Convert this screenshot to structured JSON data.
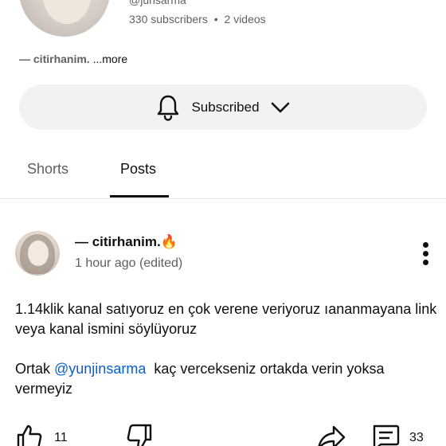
{
  "channel": {
    "handle": "@junsarma",
    "subscribers": "330 subscribers",
    "separator": "•",
    "videos": "2 videos",
    "description": "— citirhanim.",
    "more_label": "...more"
  },
  "subscribe": {
    "label": "Subscribed",
    "bell_icon": "bell-icon",
    "chevron_icon": "chevron-down-icon"
  },
  "tabs": [
    {
      "label": "Shorts",
      "active": false
    },
    {
      "label": "Posts",
      "active": true
    }
  ],
  "post": {
    "author": "— citirhanim.🔥",
    "timestamp": "1 hour ago (edited)",
    "body_line1": "1.14klik kanal satıyoruz en çok verene veriyoruz ıananmayana link veya kanal ismini söylüyoruz",
    "body2_prefix": "Ortak ",
    "mention": "@yunjinsarma",
    "body2_suffix": "  kaç vercekseniz ortakda verin yoksa vermeyiz",
    "likes": "11",
    "comments": "33"
  },
  "colors": {
    "text": "#0f0f0f",
    "muted": "#606060",
    "mention": "#065fd4",
    "chip_bg": "#f2f2f2"
  }
}
